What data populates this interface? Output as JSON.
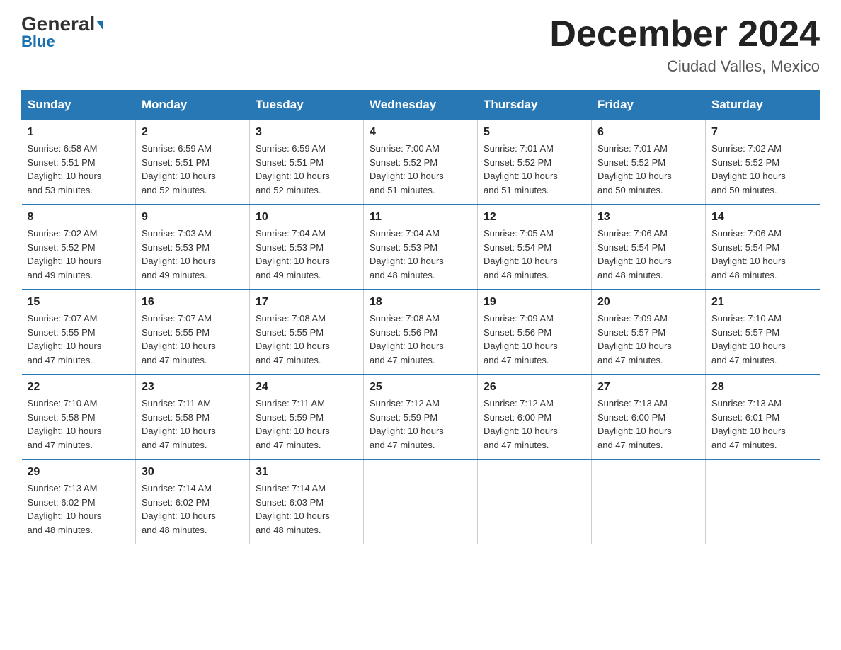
{
  "header": {
    "logo_general": "General",
    "logo_blue": "Blue",
    "main_title": "December 2024",
    "subtitle": "Ciudad Valles, Mexico"
  },
  "days_of_week": [
    "Sunday",
    "Monday",
    "Tuesday",
    "Wednesday",
    "Thursday",
    "Friday",
    "Saturday"
  ],
  "weeks": [
    [
      {
        "day": "1",
        "sunrise": "6:58 AM",
        "sunset": "5:51 PM",
        "daylight": "10 hours and 53 minutes."
      },
      {
        "day": "2",
        "sunrise": "6:59 AM",
        "sunset": "5:51 PM",
        "daylight": "10 hours and 52 minutes."
      },
      {
        "day": "3",
        "sunrise": "6:59 AM",
        "sunset": "5:51 PM",
        "daylight": "10 hours and 52 minutes."
      },
      {
        "day": "4",
        "sunrise": "7:00 AM",
        "sunset": "5:52 PM",
        "daylight": "10 hours and 51 minutes."
      },
      {
        "day": "5",
        "sunrise": "7:01 AM",
        "sunset": "5:52 PM",
        "daylight": "10 hours and 51 minutes."
      },
      {
        "day": "6",
        "sunrise": "7:01 AM",
        "sunset": "5:52 PM",
        "daylight": "10 hours and 50 minutes."
      },
      {
        "day": "7",
        "sunrise": "7:02 AM",
        "sunset": "5:52 PM",
        "daylight": "10 hours and 50 minutes."
      }
    ],
    [
      {
        "day": "8",
        "sunrise": "7:02 AM",
        "sunset": "5:52 PM",
        "daylight": "10 hours and 49 minutes."
      },
      {
        "day": "9",
        "sunrise": "7:03 AM",
        "sunset": "5:53 PM",
        "daylight": "10 hours and 49 minutes."
      },
      {
        "day": "10",
        "sunrise": "7:04 AM",
        "sunset": "5:53 PM",
        "daylight": "10 hours and 49 minutes."
      },
      {
        "day": "11",
        "sunrise": "7:04 AM",
        "sunset": "5:53 PM",
        "daylight": "10 hours and 48 minutes."
      },
      {
        "day": "12",
        "sunrise": "7:05 AM",
        "sunset": "5:54 PM",
        "daylight": "10 hours and 48 minutes."
      },
      {
        "day": "13",
        "sunrise": "7:06 AM",
        "sunset": "5:54 PM",
        "daylight": "10 hours and 48 minutes."
      },
      {
        "day": "14",
        "sunrise": "7:06 AM",
        "sunset": "5:54 PM",
        "daylight": "10 hours and 48 minutes."
      }
    ],
    [
      {
        "day": "15",
        "sunrise": "7:07 AM",
        "sunset": "5:55 PM",
        "daylight": "10 hours and 47 minutes."
      },
      {
        "day": "16",
        "sunrise": "7:07 AM",
        "sunset": "5:55 PM",
        "daylight": "10 hours and 47 minutes."
      },
      {
        "day": "17",
        "sunrise": "7:08 AM",
        "sunset": "5:55 PM",
        "daylight": "10 hours and 47 minutes."
      },
      {
        "day": "18",
        "sunrise": "7:08 AM",
        "sunset": "5:56 PM",
        "daylight": "10 hours and 47 minutes."
      },
      {
        "day": "19",
        "sunrise": "7:09 AM",
        "sunset": "5:56 PM",
        "daylight": "10 hours and 47 minutes."
      },
      {
        "day": "20",
        "sunrise": "7:09 AM",
        "sunset": "5:57 PM",
        "daylight": "10 hours and 47 minutes."
      },
      {
        "day": "21",
        "sunrise": "7:10 AM",
        "sunset": "5:57 PM",
        "daylight": "10 hours and 47 minutes."
      }
    ],
    [
      {
        "day": "22",
        "sunrise": "7:10 AM",
        "sunset": "5:58 PM",
        "daylight": "10 hours and 47 minutes."
      },
      {
        "day": "23",
        "sunrise": "7:11 AM",
        "sunset": "5:58 PM",
        "daylight": "10 hours and 47 minutes."
      },
      {
        "day": "24",
        "sunrise": "7:11 AM",
        "sunset": "5:59 PM",
        "daylight": "10 hours and 47 minutes."
      },
      {
        "day": "25",
        "sunrise": "7:12 AM",
        "sunset": "5:59 PM",
        "daylight": "10 hours and 47 minutes."
      },
      {
        "day": "26",
        "sunrise": "7:12 AM",
        "sunset": "6:00 PM",
        "daylight": "10 hours and 47 minutes."
      },
      {
        "day": "27",
        "sunrise": "7:13 AM",
        "sunset": "6:00 PM",
        "daylight": "10 hours and 47 minutes."
      },
      {
        "day": "28",
        "sunrise": "7:13 AM",
        "sunset": "6:01 PM",
        "daylight": "10 hours and 47 minutes."
      }
    ],
    [
      {
        "day": "29",
        "sunrise": "7:13 AM",
        "sunset": "6:02 PM",
        "daylight": "10 hours and 48 minutes."
      },
      {
        "day": "30",
        "sunrise": "7:14 AM",
        "sunset": "6:02 PM",
        "daylight": "10 hours and 48 minutes."
      },
      {
        "day": "31",
        "sunrise": "7:14 AM",
        "sunset": "6:03 PM",
        "daylight": "10 hours and 48 minutes."
      },
      null,
      null,
      null,
      null
    ]
  ],
  "labels": {
    "sunrise": "Sunrise:",
    "sunset": "Sunset:",
    "daylight": "Daylight:"
  }
}
